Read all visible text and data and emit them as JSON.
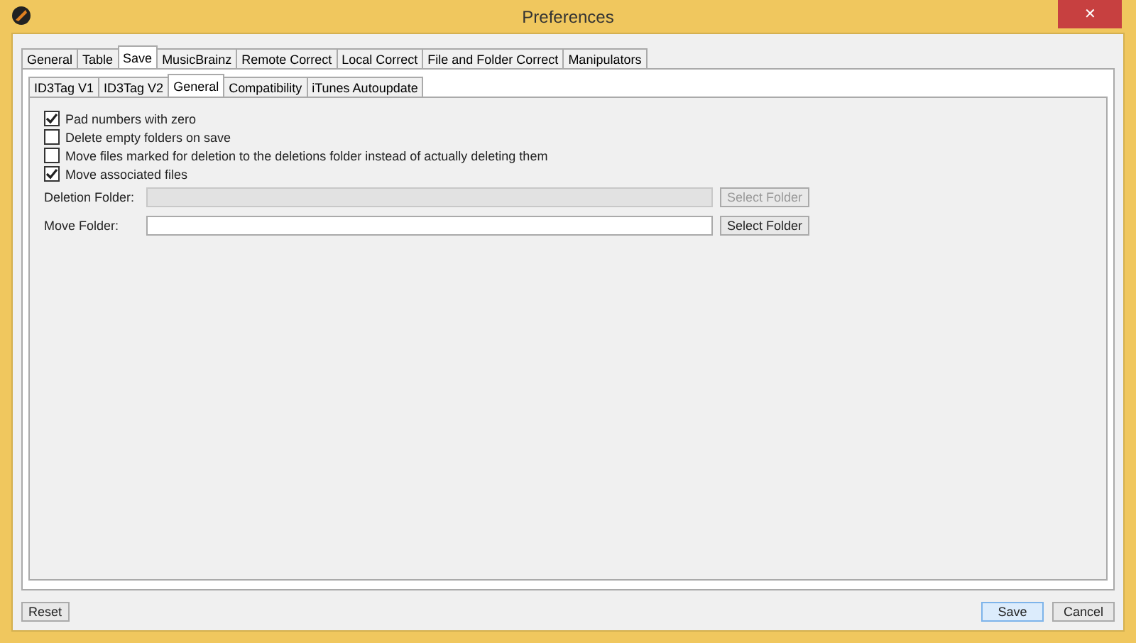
{
  "window": {
    "title": "Preferences",
    "close": "✕"
  },
  "tabs": [
    {
      "label": "General",
      "selected": false
    },
    {
      "label": "Table",
      "selected": false
    },
    {
      "label": "Save",
      "selected": true
    },
    {
      "label": "MusicBrainz",
      "selected": false
    },
    {
      "label": "Remote Correct",
      "selected": false
    },
    {
      "label": "Local Correct",
      "selected": false
    },
    {
      "label": "File and Folder Correct",
      "selected": false
    },
    {
      "label": "Manipulators",
      "selected": false
    }
  ],
  "subtabs": [
    {
      "label": "ID3Tag V1",
      "selected": false
    },
    {
      "label": "ID3Tag V2",
      "selected": false
    },
    {
      "label": "General",
      "selected": true
    },
    {
      "label": "Compatibility",
      "selected": false
    },
    {
      "label": "iTunes Autoupdate",
      "selected": false
    }
  ],
  "options": [
    {
      "label": "Pad numbers with zero",
      "checked": true
    },
    {
      "label": "Delete empty folders on save",
      "checked": false
    },
    {
      "label": "Move files marked for deletion to the deletions folder instead of actually deleting them",
      "checked": false
    },
    {
      "label": "Move associated files",
      "checked": true
    }
  ],
  "folders": [
    {
      "label": "Deletion Folder:",
      "disabled": true,
      "button": "Select Folder"
    },
    {
      "label": "Move Folder:",
      "disabled": false,
      "button": "Select Folder"
    }
  ],
  "buttons": {
    "reset": "Reset",
    "save": "Save",
    "cancel": "Cancel"
  }
}
